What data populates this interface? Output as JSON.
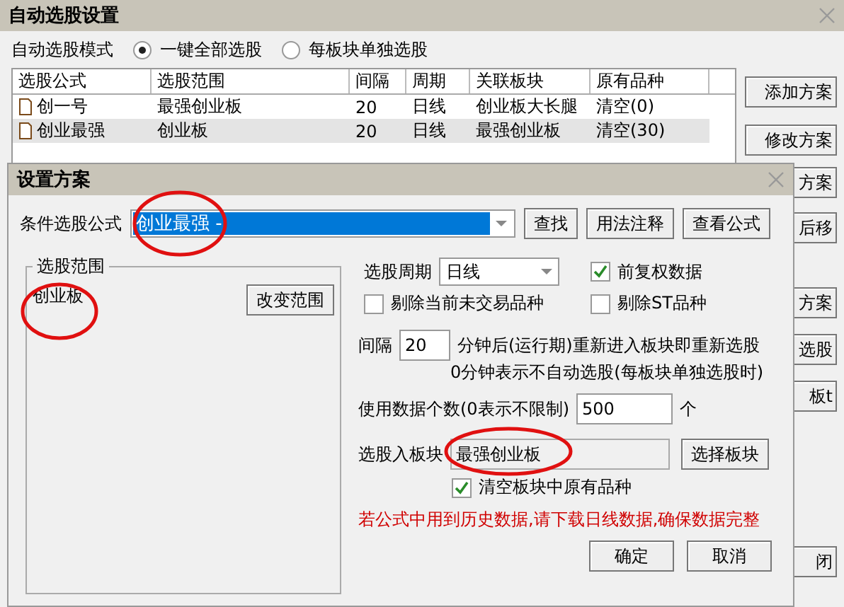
{
  "window": {
    "title": "自动选股设置"
  },
  "mode": {
    "label": "自动选股模式",
    "options": [
      {
        "label": "一键全部选股",
        "selected": true
      },
      {
        "label": "每板块单独选股",
        "selected": false
      }
    ]
  },
  "table": {
    "columns": [
      "选股公式",
      "选股范围",
      "间隔",
      "周期",
      "关联板块",
      "原有品种"
    ],
    "rows": [
      {
        "cells": [
          "创一号",
          "最强创业板",
          "20",
          "日线",
          "创业板大长腿",
          "清空(0)"
        ],
        "selected": false
      },
      {
        "cells": [
          "创业最强",
          "创业板",
          "20",
          "日线",
          "最强创业板",
          "清空(30)"
        ],
        "selected": true
      }
    ]
  },
  "side_buttons": [
    "添加方案",
    "修改方案",
    "方案",
    "后移",
    "方案",
    "选股",
    "板t",
    "闭"
  ],
  "dialog": {
    "title": "设置方案",
    "formula": {
      "label": "条件选股公式",
      "value": "创业最强 -"
    },
    "formula_buttons": [
      "查找",
      "用法注释",
      "查看公式"
    ],
    "range": {
      "legend": "选股范围",
      "value": "创业板",
      "button": "改变范围"
    },
    "period": {
      "label": "选股周期",
      "value": "日线"
    },
    "options": [
      {
        "label": "前复权数据",
        "checked": true
      },
      {
        "label": "剔除当前未交易品种",
        "checked": false
      },
      {
        "label": "剔除ST品种",
        "checked": false
      }
    ],
    "interval": {
      "label": "间隔",
      "value": "20",
      "note": "分钟后(运行期)重新进入板块即重新选股",
      "note_2": "0分钟表示不自动选股(每板块单独选股时)"
    },
    "data_count": {
      "label": "使用数据个数(0表示不限制)",
      "value": "500",
      "unit": "个"
    },
    "target_block": {
      "label": "选股入板块",
      "value": "最强创业板",
      "button": "选择板块"
    },
    "clear_block": {
      "label": "清空板块中原有品种",
      "checked": true
    },
    "warning": "若公式中用到历史数据,请下载日线数据,确保数据完整",
    "buttons": [
      "确定",
      "取消"
    ]
  }
}
